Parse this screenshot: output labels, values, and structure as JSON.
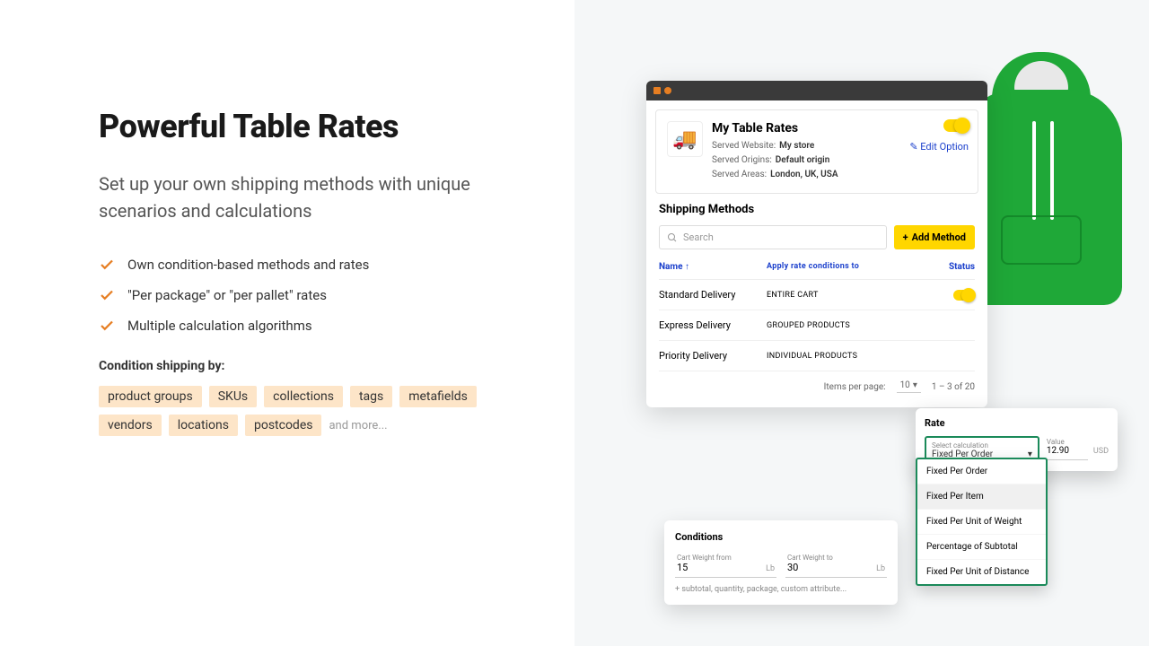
{
  "headline": "Powerful Table Rates",
  "subhead": "Set up your own shipping methods with unique scenarios and calculations",
  "features": [
    "Own condition-based methods and rates",
    "\"Per package\" or \"per pallet\" rates",
    "Multiple calculation algorithms"
  ],
  "condition_label": "Condition shipping by:",
  "condition_tags": [
    "product groups",
    "SKUs",
    "collections",
    "tags",
    "metafields",
    "vendors",
    "locations",
    "postcodes"
  ],
  "condition_more": "and more...",
  "app": {
    "title": "My Table Rates",
    "meta": {
      "website_label": "Served Website:",
      "website_value": "My store",
      "origins_label": "Served Origins:",
      "origins_value": "Default origin",
      "areas_label": "Served Areas:",
      "areas_value": "London, UK, USA"
    },
    "edit_label": "Edit Option",
    "section": "Shipping Methods",
    "search_placeholder": "Search",
    "add_label": "Add Method",
    "columns": {
      "name": "Name ↑",
      "apply": "Apply rate conditions to",
      "status": "Status"
    },
    "rows": [
      {
        "name": "Standard  Delivery",
        "apply": "ENTIRE CART",
        "toggle": true
      },
      {
        "name": "Express Delivery",
        "apply": "GROUPED PRODUCTS",
        "toggle": false
      },
      {
        "name": "Priority Delivery",
        "apply": "INDIVIDUAL PRODUCTS",
        "toggle": false
      }
    ],
    "pager": {
      "label": "Items per page:",
      "per": "10",
      "range": "1 – 3 of 20"
    }
  },
  "rate": {
    "title": "Rate",
    "select_label": "Select calculation",
    "selected": "Fixed Per Order",
    "value_label": "Value",
    "value": "12.90",
    "currency": "USD",
    "options": [
      "Fixed Per Order",
      "Fixed Per Item",
      "Fixed Per Unit of Weight",
      "Percentage of Subtotal",
      "Fixed Per Unit of Distance"
    ]
  },
  "conditions": {
    "title": "Conditions",
    "from_label": "Cart Weight from",
    "from": "15",
    "to_label": "Cart Weight to",
    "to": "30",
    "unit": "Lb",
    "more": "+ subtotal, quantity, package, custom attribute..."
  }
}
